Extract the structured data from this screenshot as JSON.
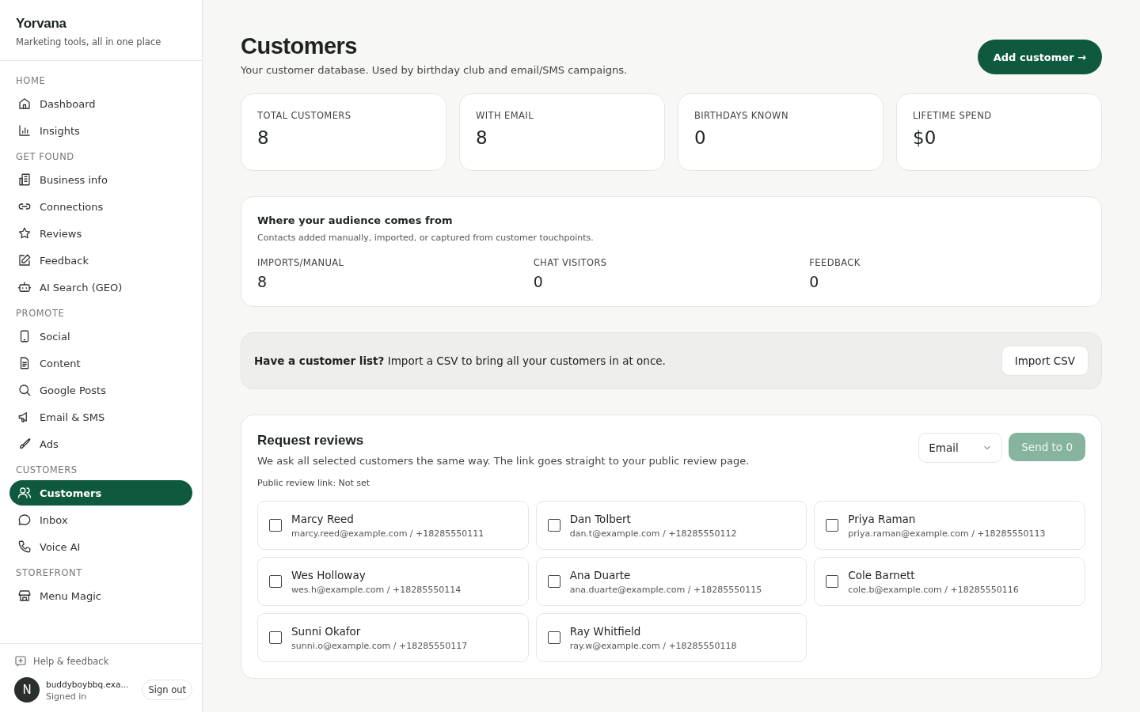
{
  "brand": {
    "name": "Yorvana",
    "tagline": "Marketing tools, all in one place"
  },
  "sidebar": {
    "sections": [
      {
        "title": "HOME",
        "items": [
          {
            "label": "Dashboard",
            "selected": false
          },
          {
            "label": "Insights",
            "selected": false
          }
        ]
      },
      {
        "title": "GET FOUND",
        "items": [
          {
            "label": "Business info",
            "selected": false
          },
          {
            "label": "Connections",
            "selected": false
          },
          {
            "label": "Reviews",
            "selected": false
          },
          {
            "label": "Feedback",
            "selected": false
          },
          {
            "label": "AI Search (GEO)",
            "selected": false
          }
        ]
      },
      {
        "title": "PROMOTE",
        "items": [
          {
            "label": "Social",
            "selected": false
          },
          {
            "label": "Content",
            "selected": false
          },
          {
            "label": "Google Posts",
            "selected": false
          },
          {
            "label": "Email & SMS",
            "selected": false
          },
          {
            "label": "Ads",
            "selected": false
          }
        ]
      },
      {
        "title": "CUSTOMERS",
        "items": [
          {
            "label": "Customers",
            "selected": true
          },
          {
            "label": "Inbox",
            "selected": false
          },
          {
            "label": "Voice AI",
            "selected": false
          }
        ]
      },
      {
        "title": "STOREFRONT",
        "items": [
          {
            "label": "Menu Magic",
            "selected": false
          }
        ]
      }
    ],
    "help": "Help & feedback",
    "avatar": "N",
    "email": "buddyboybbq.exa...",
    "status": "Signed in",
    "sign_out": "Sign out"
  },
  "header": {
    "title": "Customers",
    "subtitle": "Your customer database. Used by birthday club and email/SMS campaigns.",
    "action": "Add customer →"
  },
  "stats": [
    {
      "label": "TOTAL CUSTOMERS",
      "value": "8"
    },
    {
      "label": "WITH EMAIL",
      "value": "8"
    },
    {
      "label": "BIRTHDAYS KNOWN",
      "value": "0"
    },
    {
      "label": "LIFETIME SPEND",
      "value": "$0"
    }
  ],
  "sources": {
    "title": "Where your audience comes from",
    "subtitle": "Contacts added manually, imported, or captured from customer touchpoints.",
    "items": [
      {
        "label": "IMPORTS/MANUAL",
        "value": "8"
      },
      {
        "label": "CHAT VISITORS",
        "value": "0"
      },
      {
        "label": "FEEDBACK",
        "value": "0"
      }
    ]
  },
  "import_banner": {
    "text": "**Have a customer list?** Import a CSV to bring all your customers in at once.",
    "button": "Import CSV"
  },
  "reviews": {
    "title": "Request reviews",
    "subtitle": "We ask all selected customers the same way. The link goes straight to your public review page.",
    "link_note": "Public review link: Not set",
    "channel": "Email",
    "send": "Send to 0",
    "send_disabled": true,
    "customers": [
      {
        "name": "Marcy Reed",
        "contact": "marcy.reed@example.com / +18285550111",
        "checked": false
      },
      {
        "name": "Dan Tolbert",
        "contact": "dan.t@example.com / +18285550112",
        "checked": false
      },
      {
        "name": "Priya Raman",
        "contact": "priya.raman@example.com / +18285550113",
        "checked": false
      },
      {
        "name": "Wes Holloway",
        "contact": "wes.h@example.com / +18285550114",
        "checked": false
      },
      {
        "name": "Ana Duarte",
        "contact": "ana.duarte@example.com / +18285550115",
        "checked": false
      },
      {
        "name": "Cole Barnett",
        "contact": "cole.b@example.com / +18285550116",
        "checked": false
      },
      {
        "name": "Sunni Okafor",
        "contact": "sunni.o@example.com / +18285550117",
        "checked": false
      },
      {
        "name": "Ray Whitfield",
        "contact": "ray.w@example.com / +18285550118",
        "checked": false
      }
    ]
  }
}
